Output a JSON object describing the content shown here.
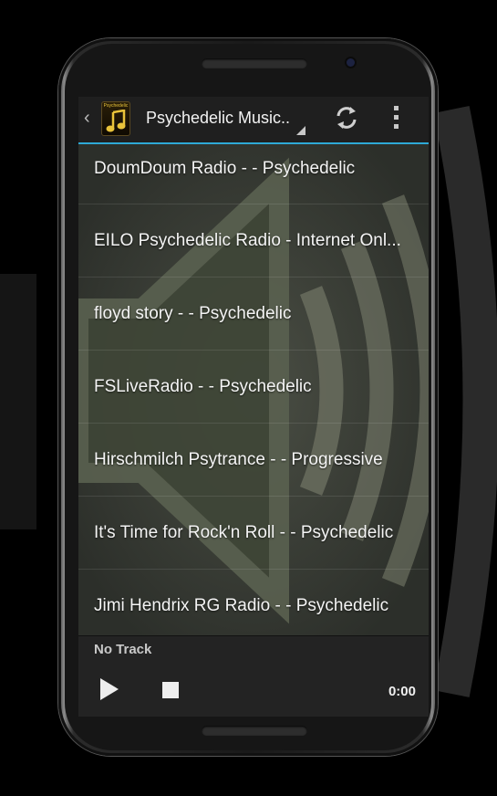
{
  "app": {
    "title": "Psychedelic Music..",
    "icon_label": "Psychedelic",
    "icons": [
      "up-caret-icon",
      "app-icon",
      "dropdown-triangle-icon",
      "refresh-icon",
      "overflow-menu-icon",
      "play-icon",
      "stop-icon"
    ],
    "accent_color": "#2ea9d6"
  },
  "stations": [
    "DoumDoum Radio - - Psychedelic",
    "EILO Psychedelic Radio - Internet Onl...",
    "floyd story - - Psychedelic",
    "FSLiveRadio - - Psychedelic",
    "Hirschmilch Psytrance - - Progressive",
    "It's Time for Rock'n Roll - - Psychedelic",
    "Jimi Hendrix RG Radio - - Psychedelic"
  ],
  "player": {
    "track": "No Track",
    "time": "0:00"
  }
}
